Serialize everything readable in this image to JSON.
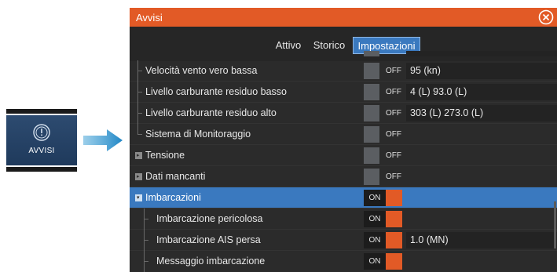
{
  "launcher": {
    "label": "AVVISI",
    "icon": "alert-circle-icon"
  },
  "dialog": {
    "title": "Avvisi",
    "close_icon": "close-circle-icon",
    "accent": "#e25a26",
    "selection_color": "#3a79bf"
  },
  "tabs": [
    {
      "label": "Attivo",
      "active": false
    },
    {
      "label": "Storico",
      "active": false
    },
    {
      "label": "Impostazioni",
      "active": true
    }
  ],
  "rows": [
    {
      "label": "Velocità vento vero bassa",
      "switch": "OFF",
      "value": "95 (kn)"
    },
    {
      "label": "Livello carburante residuo basso",
      "switch": "OFF",
      "value": "4 (L)  93.0 (L)"
    },
    {
      "label": "Livello carburante residuo alto",
      "switch": "OFF",
      "value": "303 (L)  273.0 (L)"
    },
    {
      "label": "Sistema di Monitoraggio",
      "switch": "OFF",
      "value": ""
    },
    {
      "label": "Tensione",
      "switch": "OFF",
      "value": ""
    },
    {
      "label": "Dati mancanti",
      "switch": "OFF",
      "value": ""
    },
    {
      "label": "Imbarcazioni",
      "switch": "ON",
      "value": ""
    },
    {
      "label": "Imbarcazione pericolosa",
      "switch": "ON",
      "value": ""
    },
    {
      "label": "Imbarcazione AIS persa",
      "switch": "ON",
      "value": "1.0 (MN)"
    },
    {
      "label": "Messaggio imbarcazione",
      "switch": "ON",
      "value": ""
    }
  ]
}
